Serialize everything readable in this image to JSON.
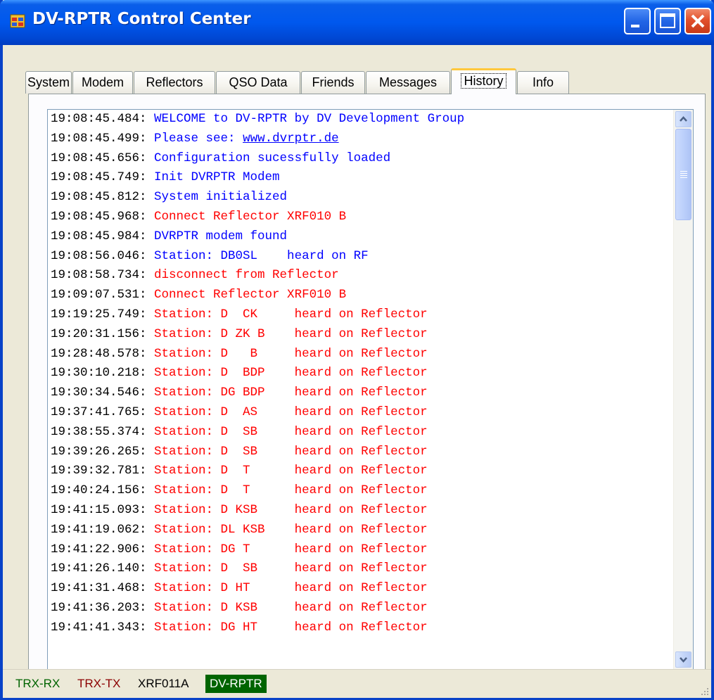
{
  "window": {
    "title": "DV-RPTR Control Center"
  },
  "tabs": [
    {
      "label": "System"
    },
    {
      "label": "Modem"
    },
    {
      "label": "Reflectors"
    },
    {
      "label": "QSO Data"
    },
    {
      "label": "Friends"
    },
    {
      "label": "Messages"
    },
    {
      "label": "History",
      "active": true
    },
    {
      "label": "Info"
    }
  ],
  "log": [
    {
      "ts": "19:08:45.484: ",
      "msg": "WELCOME to DV-RPTR by DV Development Group",
      "color": "blue"
    },
    {
      "ts": "19:08:45.499: ",
      "msg": "Please see: ",
      "link": "www.dvrptr.de",
      "color": "blue"
    },
    {
      "ts": "19:08:45.656: ",
      "msg": "Configuration sucessfully loaded",
      "color": "blue"
    },
    {
      "ts": "19:08:45.749: ",
      "msg": "Init DVRPTR Modem",
      "color": "blue"
    },
    {
      "ts": "19:08:45.812: ",
      "msg": "System initialized",
      "color": "blue"
    },
    {
      "ts": "19:08:45.968: ",
      "msg": "Connect Reflector XRF010 B",
      "color": "red"
    },
    {
      "ts": "19:08:45.984: ",
      "msg": "DVRPTR modem found",
      "color": "blue"
    },
    {
      "ts": "19:08:56.046: ",
      "msg": "Station: DB0SL    heard on RF",
      "color": "blue"
    },
    {
      "ts": "19:08:58.734: ",
      "msg": "disconnect from Reflector",
      "color": "red"
    },
    {
      "ts": "19:09:07.531: ",
      "msg": "Connect Reflector XRF010 B",
      "color": "red"
    },
    {
      "ts": "19:19:25.749: ",
      "msg": "Station: D  CK     heard on Reflector",
      "color": "red"
    },
    {
      "ts": "19:20:31.156: ",
      "msg": "Station: D ZK B    heard on Reflector",
      "color": "red"
    },
    {
      "ts": "19:28:48.578: ",
      "msg": "Station: D   B     heard on Reflector",
      "color": "red"
    },
    {
      "ts": "19:30:10.218: ",
      "msg": "Station: D  BDP    heard on Reflector",
      "color": "red"
    },
    {
      "ts": "19:30:34.546: ",
      "msg": "Station: DG BDP    heard on Reflector",
      "color": "red"
    },
    {
      "ts": "19:37:41.765: ",
      "msg": "Station: D  AS     heard on Reflector",
      "color": "red"
    },
    {
      "ts": "19:38:55.374: ",
      "msg": "Station: D  SB     heard on Reflector",
      "color": "red"
    },
    {
      "ts": "19:39:26.265: ",
      "msg": "Station: D  SB     heard on Reflector",
      "color": "red"
    },
    {
      "ts": "19:39:32.781: ",
      "msg": "Station: D  T      heard on Reflector",
      "color": "red"
    },
    {
      "ts": "19:40:24.156: ",
      "msg": "Station: D  T      heard on Reflector",
      "color": "red"
    },
    {
      "ts": "19:41:15.093: ",
      "msg": "Station: D KSB     heard on Reflector",
      "color": "red"
    },
    {
      "ts": "19:41:19.062: ",
      "msg": "Station: DL KSB    heard on Reflector",
      "color": "red"
    },
    {
      "ts": "19:41:22.906: ",
      "msg": "Station: DG T      heard on Reflector",
      "color": "red"
    },
    {
      "ts": "19:41:26.140: ",
      "msg": "Station: D  SB     heard on Reflector",
      "color": "red"
    },
    {
      "ts": "19:41:31.468: ",
      "msg": "Station: D HT      heard on Reflector",
      "color": "red"
    },
    {
      "ts": "19:41:36.203: ",
      "msg": "Station: D KSB     heard on Reflector",
      "color": "red"
    },
    {
      "ts": "19:41:41.343: ",
      "msg": "Station: DG HT     heard on Reflector",
      "color": "red"
    }
  ],
  "status": {
    "rx": "TRX-RX",
    "tx": "TRX-TX",
    "reflector": "XRF011A",
    "app": "DV-RPTR"
  },
  "colors": {
    "titlebar": "#0058ee",
    "log_blue": "#0000ff",
    "log_red": "#ff0000",
    "status_rx": "#006400",
    "status_tx": "#8b0000",
    "status_app_bg": "#006400"
  },
  "icons": {
    "app": "app-window-icon",
    "minimize": "minimize-icon",
    "maximize": "maximize-icon",
    "close": "close-icon",
    "scroll_up": "chevron-up-icon",
    "scroll_down": "chevron-down-icon",
    "size_grip": "size-grip-icon"
  }
}
